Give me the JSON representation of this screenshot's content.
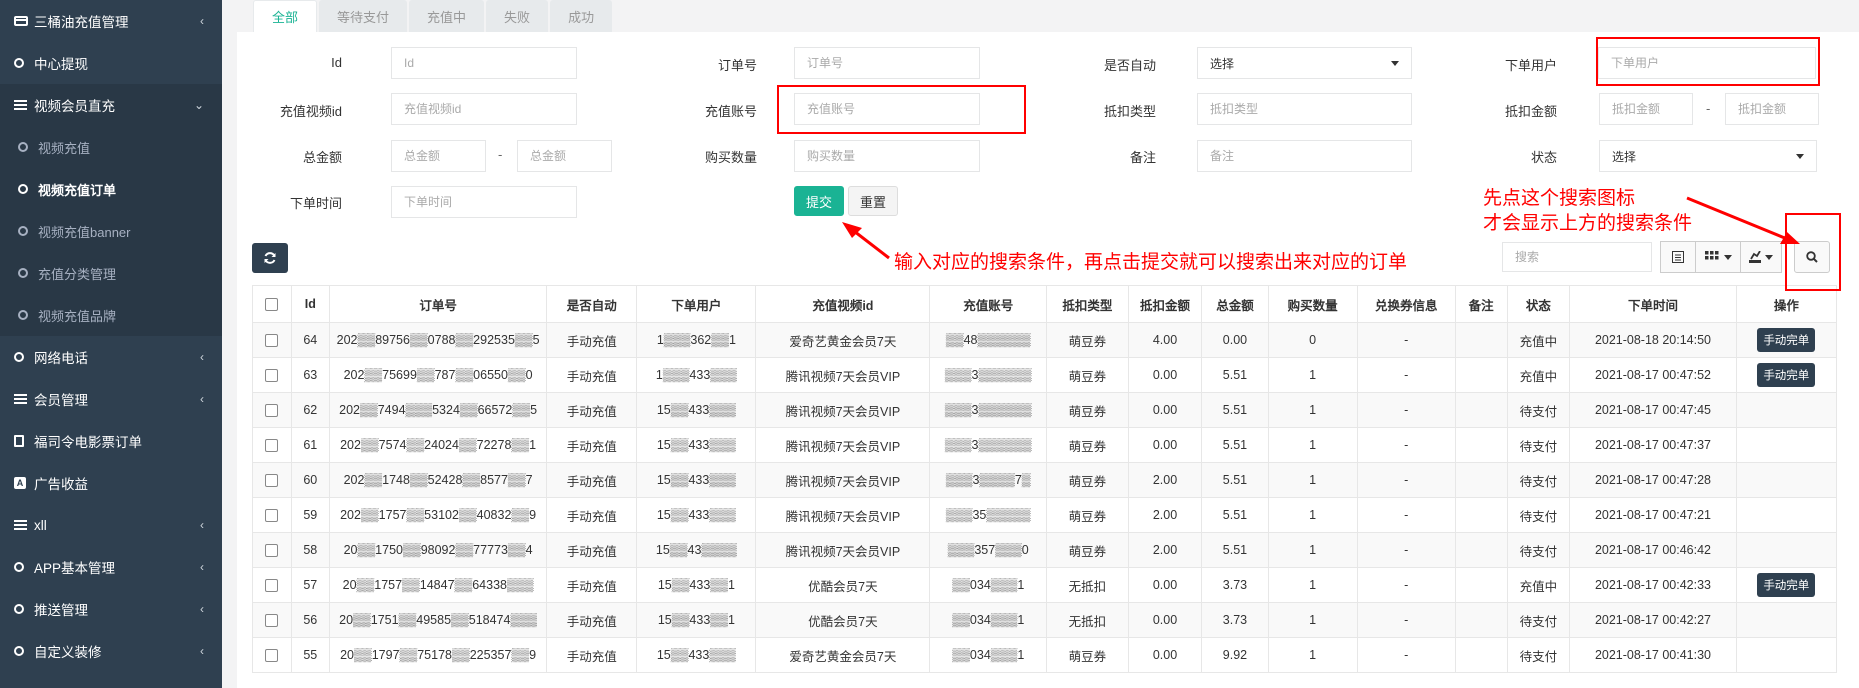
{
  "sidebar": {
    "items": [
      {
        "label": "三桶油充值管理",
        "icon": "card-icon",
        "chevron": "‹"
      },
      {
        "label": "中心提现",
        "icon": "circle-icon"
      },
      {
        "label": "视频会员直充",
        "icon": "list-icon",
        "chevron": "⌄"
      },
      {
        "label": "网络电话",
        "icon": "circle-icon",
        "chevron": "‹"
      },
      {
        "label": "会员管理",
        "icon": "list-icon",
        "chevron": "‹"
      },
      {
        "label": "福司令电影票订单",
        "icon": "document-icon"
      },
      {
        "label": "广告收益",
        "icon": "ad-icon"
      },
      {
        "label": "xll",
        "icon": "list-icon",
        "chevron": "‹"
      },
      {
        "label": "APP基本管理",
        "icon": "circle-icon",
        "chevron": "‹"
      },
      {
        "label": "推送管理",
        "icon": "circle-icon",
        "chevron": "‹"
      },
      {
        "label": "自定义装修",
        "icon": "circle-icon",
        "chevron": "‹"
      }
    ],
    "submenu": [
      {
        "label": "视频充值"
      },
      {
        "label": "视频充值订单"
      },
      {
        "label": "视频充值banner"
      },
      {
        "label": "充值分类管理"
      },
      {
        "label": "视频充值品牌"
      }
    ]
  },
  "tabs": [
    "全部",
    "等待支付",
    "充值中",
    "失败",
    "成功"
  ],
  "filters": {
    "id": {
      "label": "Id",
      "placeholder": "Id"
    },
    "order_no": {
      "label": "订单号",
      "placeholder": "订单号"
    },
    "auto": {
      "label": "是否自动",
      "value": "选择"
    },
    "user": {
      "label": "下单用户",
      "placeholder": "下单用户"
    },
    "video_id": {
      "label": "充值视频id",
      "placeholder": "充值视频id"
    },
    "account": {
      "label": "充值账号",
      "placeholder": "充值账号"
    },
    "deduct_type": {
      "label": "抵扣类型",
      "placeholder": "抵扣类型"
    },
    "deduct_amount": {
      "label": "抵扣金额",
      "placeholder_min": "抵扣金额",
      "placeholder_max": "抵扣金额"
    },
    "total": {
      "label": "总金额",
      "placeholder_min": "总金额",
      "placeholder_max": "总金额"
    },
    "quantity": {
      "label": "购买数量",
      "placeholder": "购买数量"
    },
    "remark": {
      "label": "备注",
      "placeholder": "备注"
    },
    "status": {
      "label": "状态",
      "value": "选择"
    },
    "time": {
      "label": "下单时间",
      "placeholder": "下单时间"
    },
    "range_sep": "-"
  },
  "buttons": {
    "submit": "提交",
    "reset": "重置"
  },
  "toolbar": {
    "search_placeholder": "搜索"
  },
  "annotations": {
    "submit_tip": "输入对应的搜索条件，再点击提交就可以搜索出来对应的订单",
    "search_tip_1": "先点这个搜索图标",
    "search_tip_2": "才会显示上方的搜索条件"
  },
  "table": {
    "headers": [
      "Id",
      "订单号",
      "是否自动",
      "下单用户",
      "充值视频id",
      "充值账号",
      "抵扣类型",
      "抵扣金额",
      "总金额",
      "购买数量",
      "兑换券信息",
      "备注",
      "状态",
      "下单时间",
      "操作"
    ],
    "rows": [
      {
        "id": "64",
        "order": "202▒▒89756▒▒0788▒▒292535▒▒5",
        "auto": "手动充值",
        "user": "1▒▒▒362▒▒1",
        "video": "爱奇艺黄金会员7天",
        "account": "▒▒48▒▒▒▒▒▒",
        "type": "萌豆券",
        "deduct": "4.00",
        "total": "0.00",
        "qty": "0",
        "coupon": "-",
        "remark": "",
        "status": "充值中",
        "time": "2021-08-18 20:14:50",
        "op": "手动完单"
      },
      {
        "id": "63",
        "order": "202▒▒75699▒▒787▒▒06550▒▒0",
        "auto": "手动充值",
        "user": "1▒▒▒433▒▒▒",
        "video": "腾讯视频7天会员VIP",
        "account": "▒▒▒3▒▒▒▒▒▒",
        "type": "萌豆券",
        "deduct": "0.00",
        "total": "5.51",
        "qty": "1",
        "coupon": "-",
        "remark": "",
        "status": "充值中",
        "time": "2021-08-17 00:47:52",
        "op": "手动完单"
      },
      {
        "id": "62",
        "order": "202▒▒7494▒▒▒5324▒▒66572▒▒5",
        "auto": "手动充值",
        "user": "15▒▒433▒▒▒",
        "video": "腾讯视频7天会员VIP",
        "account": "▒▒▒3▒▒▒▒▒▒",
        "type": "萌豆券",
        "deduct": "0.00",
        "total": "5.51",
        "qty": "1",
        "coupon": "-",
        "remark": "",
        "status": "待支付",
        "time": "2021-08-17 00:47:45",
        "op": ""
      },
      {
        "id": "61",
        "order": "202▒▒7574▒▒24024▒▒72278▒▒1",
        "auto": "手动充值",
        "user": "15▒▒433▒▒▒",
        "video": "腾讯视频7天会员VIP",
        "account": "▒▒▒3▒▒▒▒▒▒",
        "type": "萌豆券",
        "deduct": "0.00",
        "total": "5.51",
        "qty": "1",
        "coupon": "-",
        "remark": "",
        "status": "待支付",
        "time": "2021-08-17 00:47:37",
        "op": ""
      },
      {
        "id": "60",
        "order": "202▒▒1748▒▒52428▒▒8577▒▒7",
        "auto": "手动充值",
        "user": "15▒▒433▒▒▒",
        "video": "腾讯视频7天会员VIP",
        "account": "▒▒▒3▒▒▒▒7▒",
        "type": "萌豆券",
        "deduct": "2.00",
        "total": "5.51",
        "qty": "1",
        "coupon": "-",
        "remark": "",
        "status": "待支付",
        "time": "2021-08-17 00:47:28",
        "op": ""
      },
      {
        "id": "59",
        "order": "202▒▒1757▒▒53102▒▒40832▒▒9",
        "auto": "手动充值",
        "user": "15▒▒433▒▒▒",
        "video": "腾讯视频7天会员VIP",
        "account": "▒▒▒35▒▒▒▒▒",
        "type": "萌豆券",
        "deduct": "2.00",
        "total": "5.51",
        "qty": "1",
        "coupon": "-",
        "remark": "",
        "status": "待支付",
        "time": "2021-08-17 00:47:21",
        "op": ""
      },
      {
        "id": "58",
        "order": "20▒▒1750▒▒98092▒▒77773▒▒4",
        "auto": "手动充值",
        "user": "15▒▒43▒▒▒▒",
        "video": "腾讯视频7天会员VIP",
        "account": "▒▒▒357▒▒▒0",
        "type": "萌豆券",
        "deduct": "2.00",
        "total": "5.51",
        "qty": "1",
        "coupon": "-",
        "remark": "",
        "status": "待支付",
        "time": "2021-08-17 00:46:42",
        "op": ""
      },
      {
        "id": "57",
        "order": "20▒▒1757▒▒14847▒▒64338▒▒▒",
        "auto": "手动充值",
        "user": "15▒▒433▒▒1",
        "video": "优酷会员7天",
        "account": "▒▒034▒▒▒1",
        "type": "无抵扣",
        "deduct": "0.00",
        "total": "3.73",
        "qty": "1",
        "coupon": "-",
        "remark": "",
        "status": "充值中",
        "time": "2021-08-17 00:42:33",
        "op": "手动完单"
      },
      {
        "id": "56",
        "order": "20▒▒1751▒▒49585▒▒518474▒▒▒",
        "auto": "手动充值",
        "user": "15▒▒433▒▒1",
        "video": "优酷会员7天",
        "account": "▒▒034▒▒▒1",
        "type": "无抵扣",
        "deduct": "0.00",
        "total": "3.73",
        "qty": "1",
        "coupon": "-",
        "remark": "",
        "status": "待支付",
        "time": "2021-08-17 00:42:27",
        "op": ""
      },
      {
        "id": "55",
        "order": "20▒▒1797▒▒75178▒▒225357▒▒9",
        "auto": "手动充值",
        "user": "15▒▒433▒▒▒",
        "video": "爱奇艺黄金会员7天",
        "account": "▒▒034▒▒▒1",
        "type": "萌豆券",
        "deduct": "0.00",
        "total": "9.92",
        "qty": "1",
        "coupon": "-",
        "remark": "",
        "status": "待支付",
        "time": "2021-08-17 00:41:30",
        "op": ""
      }
    ]
  },
  "colors": {
    "sidebar": "#2f4050",
    "primary": "#1ab394",
    "annotation": "#ff0000"
  }
}
